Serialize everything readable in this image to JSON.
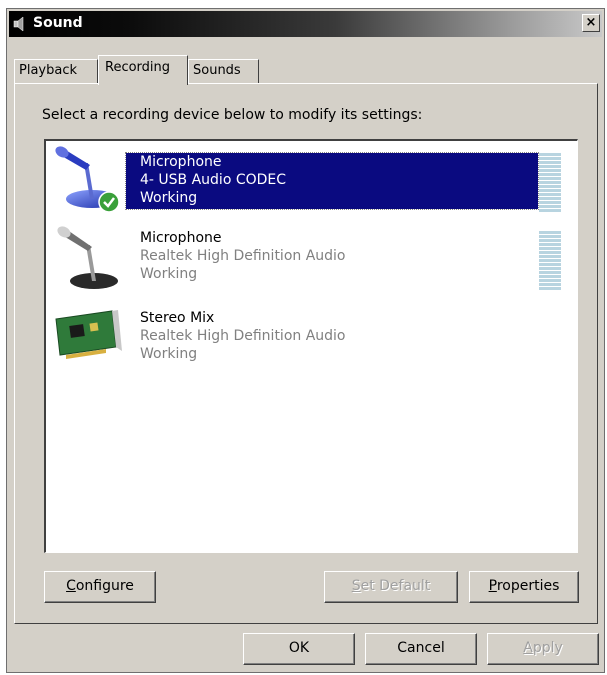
{
  "window": {
    "title": "Sound",
    "close_label": "×"
  },
  "tabs": [
    {
      "label": "Playback",
      "active": false
    },
    {
      "label": "Recording",
      "active": true
    },
    {
      "label": "Sounds",
      "active": false
    }
  ],
  "instruction": "Select a recording device below to modify its settings:",
  "devices": [
    {
      "name": "Microphone",
      "description": "4- USB Audio CODEC",
      "status": "Working",
      "selected": true,
      "default": true,
      "icon": "microphone-icon"
    },
    {
      "name": "Microphone",
      "description": "Realtek High Definition Audio",
      "status": "Working",
      "selected": false,
      "default": false,
      "icon": "microphone-icon"
    },
    {
      "name": "Stereo Mix",
      "description": "Realtek High Definition Audio",
      "status": "Working",
      "selected": false,
      "default": false,
      "icon": "sound-card-icon"
    }
  ],
  "panel_buttons": {
    "configure": {
      "accel": "C",
      "rest": "onfigure",
      "enabled": true
    },
    "set_default": {
      "accel": "S",
      "rest": "et Default",
      "enabled": false
    },
    "properties": {
      "accel": "P",
      "rest": "roperties",
      "enabled": true
    }
  },
  "dialog_buttons": {
    "ok": "OK",
    "cancel": "Cancel",
    "apply": {
      "accel": "A",
      "rest": "pply",
      "enabled": false
    }
  },
  "colors": {
    "selection": "#0a0a80",
    "face": "#d4d0c8",
    "level_meter": "#b8d4e0",
    "default_check": "#3aa03a"
  }
}
